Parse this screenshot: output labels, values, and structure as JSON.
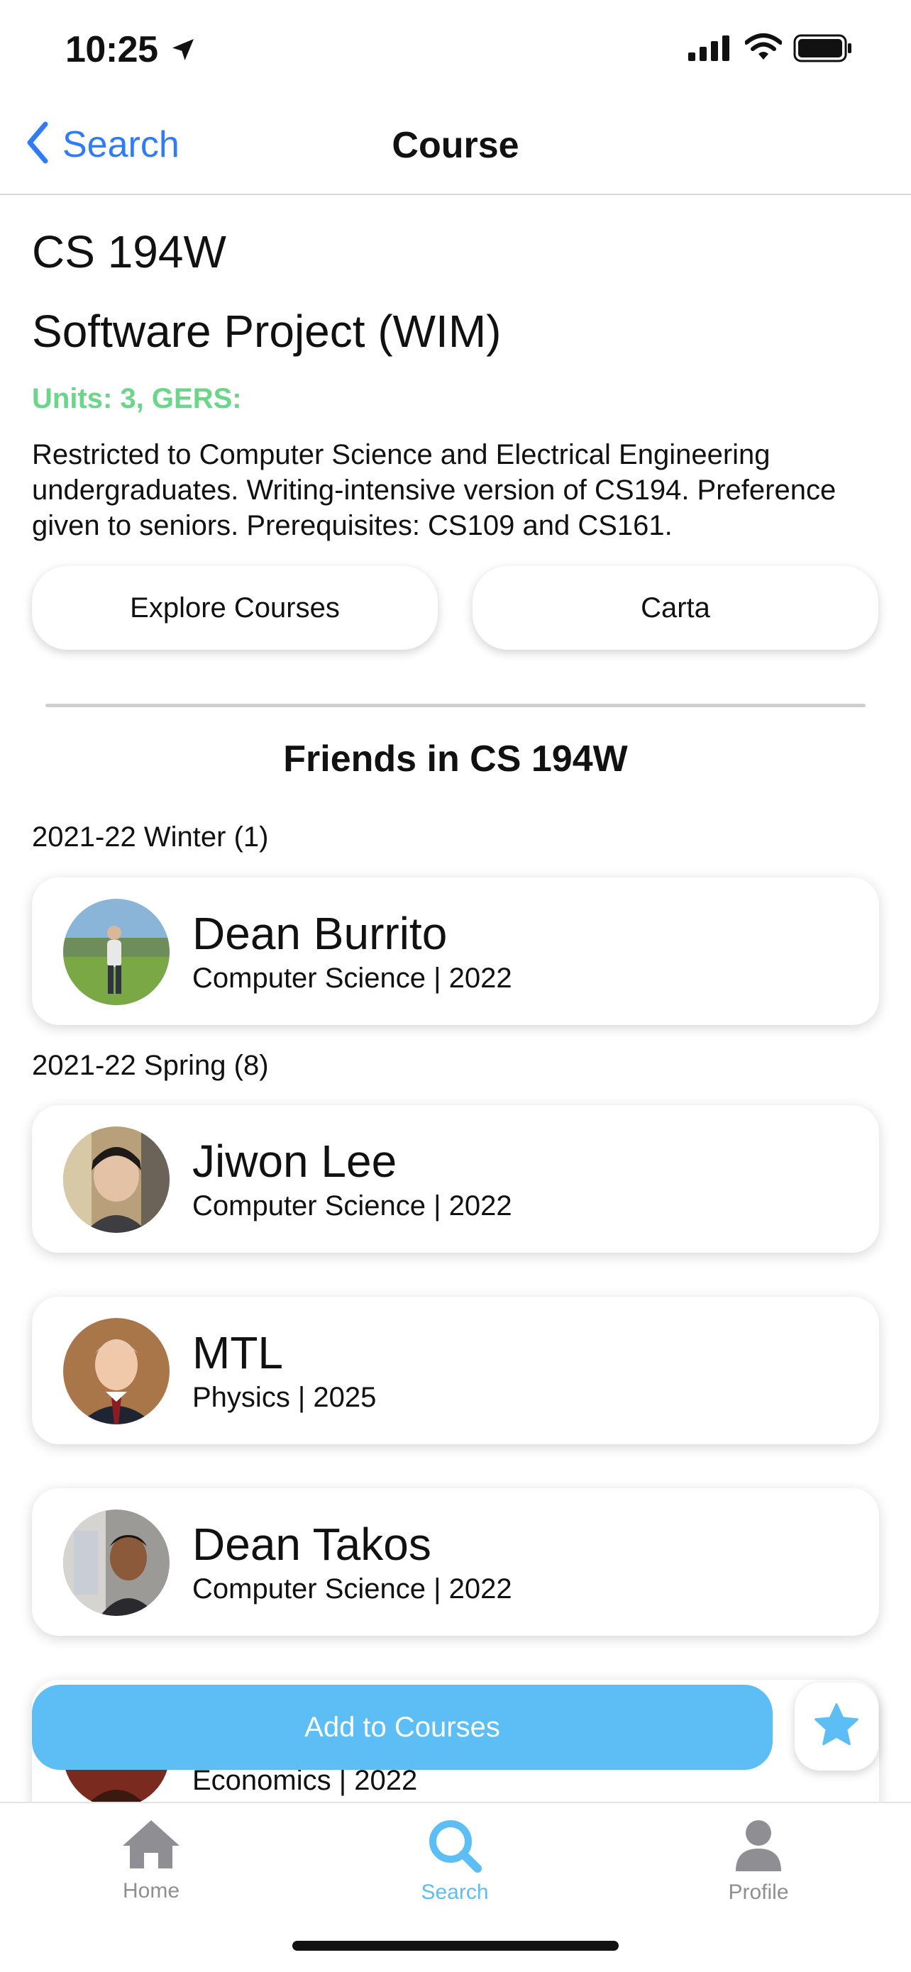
{
  "status_bar": {
    "time": "10:25"
  },
  "nav": {
    "back_label": "Search",
    "title": "Course"
  },
  "course": {
    "code": "CS 194W",
    "name": "Software Project (WIM)",
    "units_line": "Units: 3, GERS:",
    "description": "Restricted to Computer Science and Electrical Engineering undergraduates.  Writing-intensive version of CS194. Preference given to seniors. Prerequisites: CS109 and CS161."
  },
  "buttons": {
    "explore": "Explore Courses",
    "carta": "Carta",
    "add": "Add to Courses"
  },
  "friends": {
    "title": "Friends in CS 194W",
    "sections": [
      {
        "label": "2021-22 Winter (1)",
        "people": [
          {
            "name": "Dean Burrito",
            "subtitle": "Computer Science | 2022"
          }
        ]
      },
      {
        "label": "2021-22 Spring (8)",
        "people": [
          {
            "name": "Jiwon Lee",
            "subtitle": "Computer Science | 2022"
          },
          {
            "name": "MTL",
            "subtitle": "Physics | 2025"
          },
          {
            "name": "Dean Takos",
            "subtitle": "Computer Science | 2022"
          },
          {
            "name": "",
            "subtitle": "Economics | 2022"
          }
        ]
      }
    ]
  },
  "tabs": [
    {
      "label": "Home",
      "icon": "home-icon"
    },
    {
      "label": "Search",
      "icon": "search-icon"
    },
    {
      "label": "Profile",
      "icon": "profile-icon"
    }
  ],
  "colors": {
    "accent": "#5cbef5",
    "link": "#2f7cf6",
    "units_green": "#6bd68a",
    "inactive_tab": "#8e8e93"
  }
}
